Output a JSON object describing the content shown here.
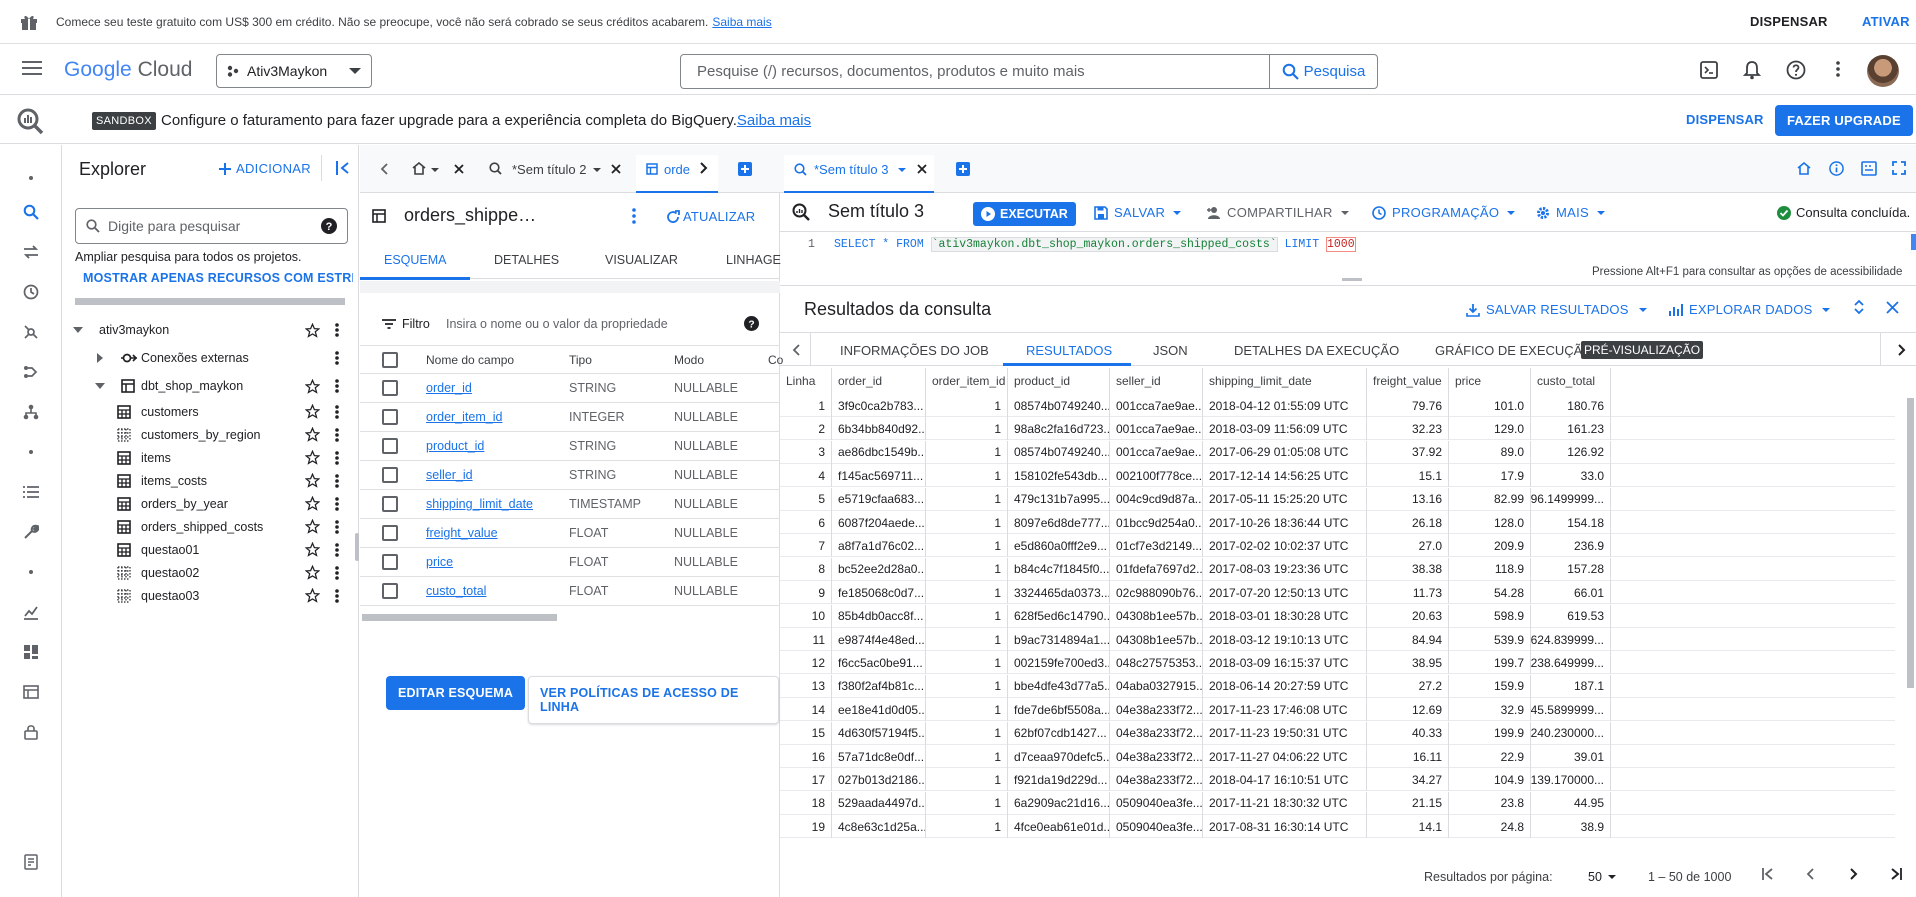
{
  "promo": {
    "text": "Comece seu teste gratuito com US$ 300 em crédito. Não se preocupe, você não será cobrado se seus créditos acabarem.",
    "link": "Saiba mais",
    "dismiss": "DISPENSAR",
    "activate": "ATIVAR"
  },
  "header": {
    "logo_google": "Google",
    "logo_cloud": "Cloud",
    "project": "Ativ3Maykon",
    "search_placeholder": "Pesquise (/) recursos, documentos, produtos e muito mais",
    "search_button": "Pesquisa"
  },
  "sandbox": {
    "badge": "SANDBOX",
    "text": "Configure o faturamento para fazer upgrade para a experiência completa do BigQuery.",
    "link": "Saiba mais",
    "dismiss": "DISPENSAR",
    "upgrade": "FAZER UPGRADE"
  },
  "explorer": {
    "title": "Explorer",
    "add": "ADICIONAR",
    "search_placeholder": "Digite para pesquisar",
    "expand_text": "Ampliar pesquisa para todos os projetos.",
    "starred_link": "MOSTRAR APENAS RECURSOS COM ESTRELA",
    "project": "ativ3maykon",
    "connections": "Conexões externas",
    "dataset": "dbt_shop_maykon",
    "tables": [
      {
        "name": "customers",
        "kind": "table"
      },
      {
        "name": "customers_by_region",
        "kind": "view"
      },
      {
        "name": "items",
        "kind": "table"
      },
      {
        "name": "items_costs",
        "kind": "table"
      },
      {
        "name": "orders_by_year",
        "kind": "table"
      },
      {
        "name": "orders_shipped_costs",
        "kind": "table"
      },
      {
        "name": "questao01",
        "kind": "table"
      },
      {
        "name": "questao02",
        "kind": "view"
      },
      {
        "name": "questao03",
        "kind": "view"
      }
    ]
  },
  "mid": {
    "tab2": "*Sem título 2",
    "tab3": "orde",
    "title": "orders_shippe…",
    "refresh": "ATUALIZAR",
    "tabs": [
      "ESQUEMA",
      "DETALHES",
      "VISUALIZAR",
      "LINHAGE"
    ],
    "filter_label": "Filtro",
    "filter_placeholder": "Insira o nome ou o valor da propriedade",
    "cols": [
      "Nome do campo",
      "Tipo",
      "Modo",
      "Co"
    ],
    "fields": [
      {
        "name": "order_id",
        "type": "STRING",
        "mode": "NULLABLE"
      },
      {
        "name": "order_item_id",
        "type": "INTEGER",
        "mode": "NULLABLE"
      },
      {
        "name": "product_id",
        "type": "STRING",
        "mode": "NULLABLE"
      },
      {
        "name": "seller_id",
        "type": "STRING",
        "mode": "NULLABLE"
      },
      {
        "name": "shipping_limit_date",
        "type": "TIMESTAMP",
        "mode": "NULLABLE"
      },
      {
        "name": "freight_value",
        "type": "FLOAT",
        "mode": "NULLABLE"
      },
      {
        "name": "price",
        "type": "FLOAT",
        "mode": "NULLABLE"
      },
      {
        "name": "custo_total",
        "type": "FLOAT",
        "mode": "NULLABLE"
      }
    ],
    "edit_schema": "EDITAR ESQUEMA",
    "policies": "VER POLÍTICAS DE ACESSO DE LINHA"
  },
  "query": {
    "tab": "*Sem título 3",
    "title": "Sem título 3",
    "run": "EXECUTAR",
    "save": "SALVAR",
    "share": "COMPARTILHAR",
    "schedule": "PROGRAMAÇÃO",
    "more": "MAIS",
    "status": "Consulta concluída.",
    "line_no": "1",
    "sql_kw1": "SELECT * FROM ",
    "sql_table": "`ativ3maykon.dbt_shop_maykon.orders_shipped_costs`",
    "sql_kw2": " LIMIT ",
    "sql_limit": "1000",
    "a11y_hint": "Pressione Alt+F1 para consultar as opções de acessibilidade"
  },
  "results": {
    "title": "Resultados da consulta",
    "save_results": "SALVAR RESULTADOS",
    "explore": "EXPLORAR DADOS",
    "tabs": [
      "INFORMAÇÕES DO JOB",
      "RESULTADOS",
      "JSON",
      "DETALHES DA EXECUÇÃO",
      "GRÁFICO DE EXECUÇÃO"
    ],
    "preview_badge": "PRÉ-VISUALIZAÇÃO",
    "columns": [
      "Linha",
      "order_id",
      "order_item_id",
      "product_id",
      "seller_id",
      "shipping_limit_date",
      "freight_value",
      "price",
      "custo_total"
    ],
    "rows": [
      [
        "1",
        "3f9c0ca2b783...",
        "1",
        "08574b0749240...",
        "001cca7ae9ae...",
        "2018-04-12 01:55:09 UTC",
        "79.76",
        "101.0",
        "180.76"
      ],
      [
        "2",
        "6b34bb840d92...",
        "1",
        "98a8c2fa16d723...",
        "001cca7ae9ae...",
        "2018-03-09 11:56:09 UTC",
        "32.23",
        "129.0",
        "161.23"
      ],
      [
        "3",
        "ae86dbc1549b...",
        "1",
        "08574b0749240...",
        "001cca7ae9ae...",
        "2017-06-29 01:05:08 UTC",
        "37.92",
        "89.0",
        "126.92"
      ],
      [
        "4",
        "f145ac569711...",
        "1",
        "158102fe543db...",
        "002100f778ce...",
        "2017-12-14 14:56:25 UTC",
        "15.1",
        "17.9",
        "33.0"
      ],
      [
        "5",
        "e5719cfaa683...",
        "1",
        "479c131b7a995...",
        "004c9cd9d87a...",
        "2017-05-11 15:25:20 UTC",
        "13.16",
        "82.99",
        "96.1499999..."
      ],
      [
        "6",
        "6087f204aede...",
        "1",
        "8097e6d8de777...",
        "01bcc9d254a0...",
        "2017-10-26 18:36:44 UTC",
        "26.18",
        "128.0",
        "154.18"
      ],
      [
        "7",
        "a8f7a1d76c02...",
        "1",
        "e5d860a0fff2e9...",
        "01cf7e3d2149...",
        "2017-02-02 10:02:37 UTC",
        "27.0",
        "209.9",
        "236.9"
      ],
      [
        "8",
        "bc52ee2d28a0...",
        "1",
        "b84c4c7f1845f0...",
        "01fdefa7697d2...",
        "2017-08-03 19:23:36 UTC",
        "38.38",
        "118.9",
        "157.28"
      ],
      [
        "9",
        "fe185068c0d7...",
        "1",
        "3324465da0373...",
        "02c988090b76...",
        "2017-07-20 12:50:13 UTC",
        "11.73",
        "54.28",
        "66.01"
      ],
      [
        "10",
        "85b4db0acc8f...",
        "1",
        "628f5ed6c14790...",
        "04308b1ee57b...",
        "2018-03-01 18:30:28 UTC",
        "20.63",
        "598.9",
        "619.53"
      ],
      [
        "11",
        "e9874f4e48ed...",
        "1",
        "b9ac7314894a1...",
        "04308b1ee57b...",
        "2018-03-12 19:10:13 UTC",
        "84.94",
        "539.9",
        "624.839999..."
      ],
      [
        "12",
        "f6cc5ac0be91...",
        "1",
        "002159fe700ed3...",
        "048c27575353...",
        "2018-03-09 16:15:37 UTC",
        "38.95",
        "199.7",
        "238.649999..."
      ],
      [
        "13",
        "f380f2af4b81c...",
        "1",
        "bbe4dfe43d77a5...",
        "04aba0327915...",
        "2018-06-14 20:27:59 UTC",
        "27.2",
        "159.9",
        "187.1"
      ],
      [
        "14",
        "ee18e41d0d05...",
        "1",
        "fde7de6bf5508a...",
        "04e38a233f72...",
        "2017-11-23 17:46:08 UTC",
        "12.69",
        "32.9",
        "45.5899999..."
      ],
      [
        "15",
        "4d630f57194f5...",
        "1",
        "62bf07cdb1427...",
        "04e38a233f72...",
        "2017-11-23 19:50:31 UTC",
        "40.33",
        "199.9",
        "240.230000..."
      ],
      [
        "16",
        "57a71dc8e0df...",
        "1",
        "d7ceaa970defc5...",
        "04e38a233f72...",
        "2017-11-27 04:06:22 UTC",
        "16.11",
        "22.9",
        "39.01"
      ],
      [
        "17",
        "027b013d2186...",
        "1",
        "f921da19d229d...",
        "04e38a233f72...",
        "2018-04-17 16:10:51 UTC",
        "34.27",
        "104.9",
        "139.170000..."
      ],
      [
        "18",
        "529aada4497d...",
        "1",
        "6a2909ac21d16...",
        "0509040ea3fe...",
        "2017-11-21 18:30:32 UTC",
        "21.15",
        "23.8",
        "44.95"
      ],
      [
        "19",
        "4c8e63c1d25a...",
        "1",
        "4fce0eab61e01d...",
        "0509040ea3fe...",
        "2017-08-31 16:30:14 UTC",
        "14.1",
        "24.8",
        "38.9"
      ]
    ],
    "per_page_label": "Resultados por página:",
    "per_page": "50",
    "range": "1 – 50 de 1000"
  }
}
